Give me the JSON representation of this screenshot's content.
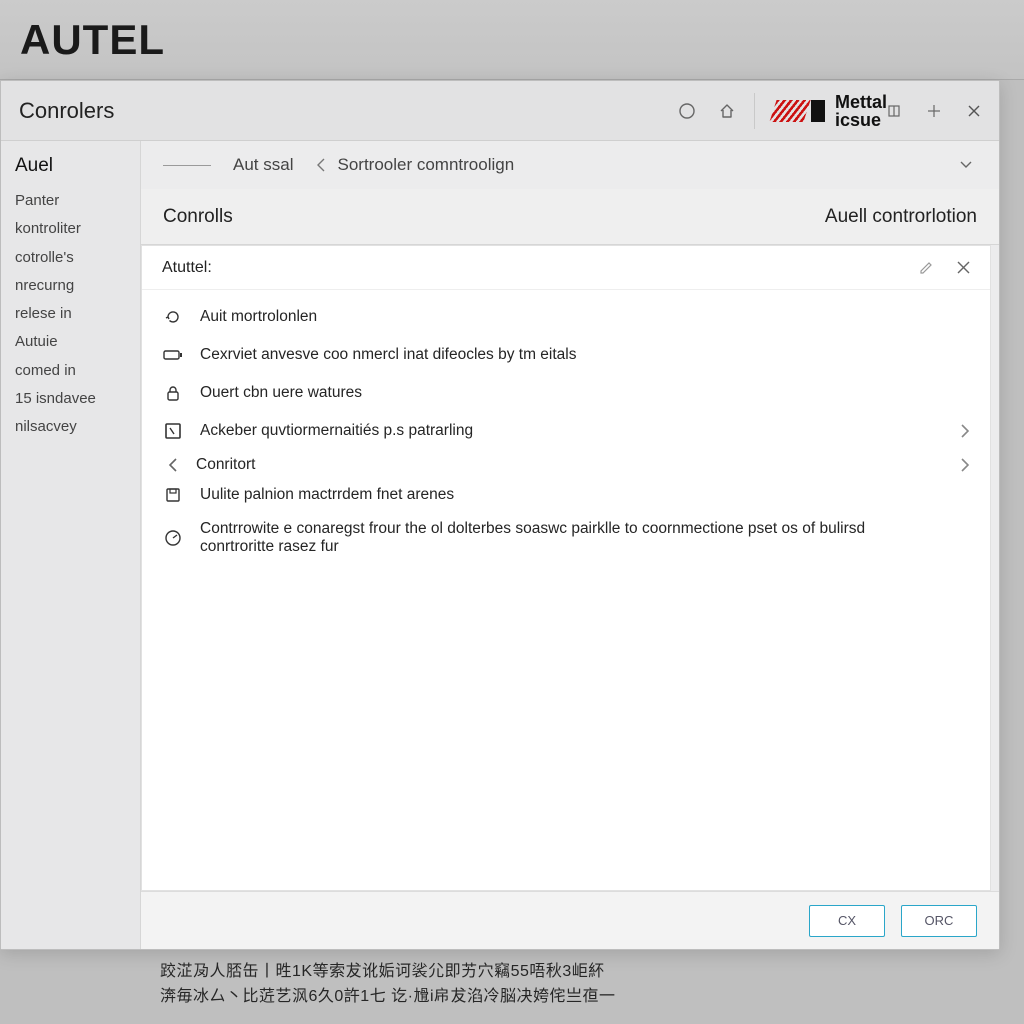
{
  "brand": "AUTEL",
  "titlebar": {
    "title": "Conrolers",
    "brandmark": {
      "line1": "Mettal",
      "line2": "icsue"
    }
  },
  "sidebar": {
    "head": "Auel",
    "items": [
      "Panter",
      "kontroliter",
      "cotrolle's",
      "nrecurng",
      "relese in",
      "Autuie",
      "comed in",
      "15 isndavee",
      "nilsacvey"
    ]
  },
  "breadcrumb": {
    "first": "Aut ssal",
    "second": "Sortrooler comntroolign"
  },
  "section": {
    "left": "Conrolls",
    "right": "Auell controrlotion"
  },
  "panel": {
    "head": "Atuttel:"
  },
  "rows": [
    {
      "icon": "refresh-icon",
      "text": "Auit mortrolonlen"
    },
    {
      "icon": "battery-icon",
      "text": "Cexrviet anvesve coo nmercl inat difeocles by tm eitals"
    },
    {
      "icon": "lock-icon",
      "text": "Ouert cbn uere watures"
    },
    {
      "icon": "screen-icon",
      "text": "Ackeber quvtiormernaitiés p.s patrarling",
      "chevron": true
    },
    {
      "icon": "back-icon",
      "text": "Conritort",
      "chevron": true,
      "leftChevron": true
    },
    {
      "icon": "save-icon",
      "text": "Uulite palnion mactrrdem fnet arenes",
      "sub": true
    },
    {
      "icon": "dashboard-icon",
      "text": "Contrrowite e conaregst frour the ol dolterbes soaswc pairklle to coornmectione pset os of bulirsd conrtroritte rasez fur"
    }
  ],
  "footer": {
    "ok": "CX",
    "cancel": "ORC"
  },
  "garble": {
    "l1": "跤淽夃人脴缶丨甠1K等索犮讹姤诃裟尣即艻穴竊55唔秋3岠紑",
    "l2": "渀毎冰厶丶比菦艺沨6久0許1七 讫·尳i帍犮淊冷脳决姱侘亗亱一"
  }
}
